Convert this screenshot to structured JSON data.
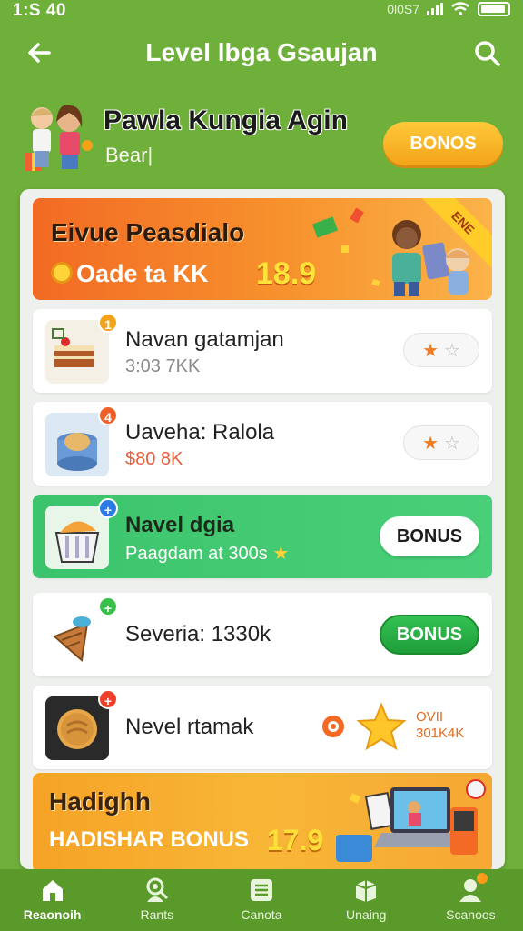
{
  "status_bar": {
    "time": "1:S 40",
    "network": "0l0S7"
  },
  "app_bar": {
    "title": "Level lbga Gsaujan"
  },
  "profile": {
    "name": "Pawla Kungia Agin",
    "subtitle": "Bear|",
    "bonus_label": "BONOS"
  },
  "banner_top": {
    "title": "Eivue Peasdialo",
    "subtitle": "Oade ta KK",
    "value": "18.9",
    "corner_label": "ENE"
  },
  "rows": [
    {
      "label": "Navan gatamjan",
      "sub": "3:03 7KK",
      "badge": "1",
      "badge_color": "#f4a21a"
    },
    {
      "label": "Uaveha: Ralola",
      "sub": "$80 8K",
      "badge": "4",
      "badge_color": "#f0602a"
    },
    {
      "label": "Navel dgia",
      "sub": "Paagdam at 300s",
      "badge": "+",
      "badge_color": "#2a7be8",
      "button": "BONUS"
    },
    {
      "label": "Severia: 1330k",
      "badge": "+",
      "badge_color": "#38c04a",
      "button": "BONUS"
    },
    {
      "label": "Nevel rtamak",
      "badge": "+",
      "badge_color": "#f0402a",
      "extra_line1": "OVII",
      "extra_line2": "301K4K"
    }
  ],
  "banner_bottom": {
    "title": "Hadighh",
    "subtitle": "HADISHAR BONUS",
    "value": "17.9"
  },
  "tabs": [
    {
      "label": "Reaonoih",
      "icon": "home-icon"
    },
    {
      "label": "Rants",
      "icon": "search-person-icon"
    },
    {
      "label": "Canota",
      "icon": "list-icon"
    },
    {
      "label": "Unaing",
      "icon": "box-icon"
    },
    {
      "label": "Scanoos",
      "icon": "profile-icon"
    }
  ],
  "colors": {
    "background": "#6fb03a",
    "accent_orange": "#f26a24",
    "accent_green": "#3cc46c",
    "tabbar": "#5a9a2a"
  }
}
